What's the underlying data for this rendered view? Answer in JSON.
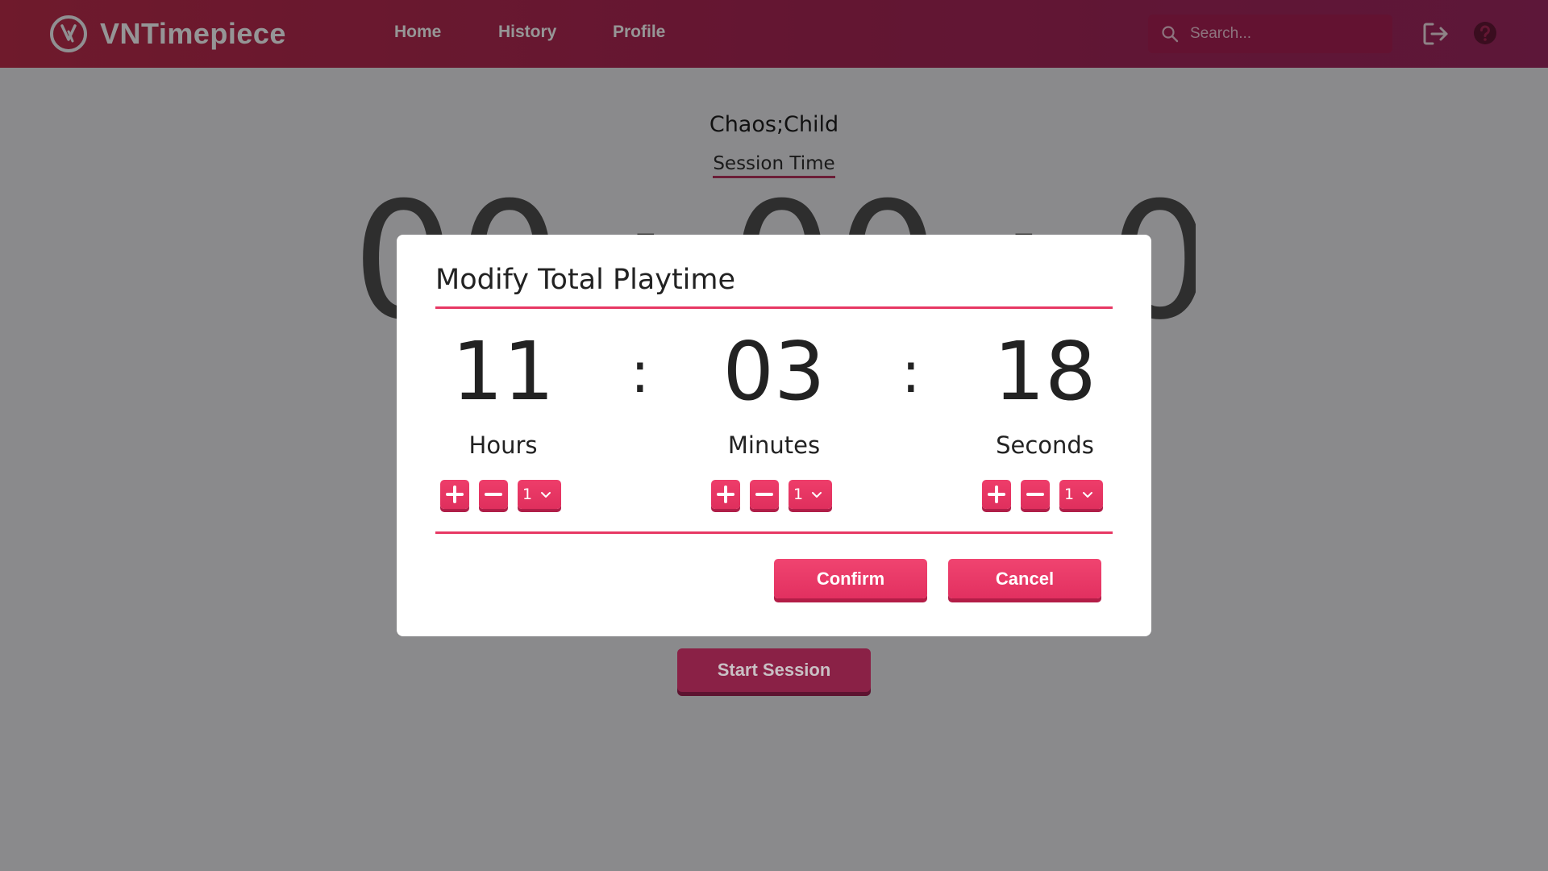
{
  "app": {
    "name": "VNTimepiece"
  },
  "nav": {
    "links": [
      "Home",
      "History",
      "Profile"
    ],
    "search_placeholder": "Search..."
  },
  "page": {
    "game_title": "Chaos;Child",
    "session_label": "Session Time",
    "timer_display": "00 : 00 : 00",
    "start_button": "Start Session"
  },
  "modal": {
    "title": "Modify Total Playtime",
    "units": [
      {
        "value": "11",
        "label": "Hours",
        "step": "1"
      },
      {
        "value": "03",
        "label": "Minutes",
        "step": "1"
      },
      {
        "value": "18",
        "label": "Seconds",
        "step": "1"
      }
    ],
    "separator": ":",
    "confirm_label": "Confirm",
    "cancel_label": "Cancel"
  },
  "colors": {
    "accent": "#e73864",
    "navbar": "#a02452",
    "overlay": "#8a8a8c"
  },
  "icons": [
    "logo-icon",
    "search-icon",
    "logout-icon",
    "help-icon",
    "plus-icon",
    "minus-icon",
    "chevron-down-icon"
  ]
}
